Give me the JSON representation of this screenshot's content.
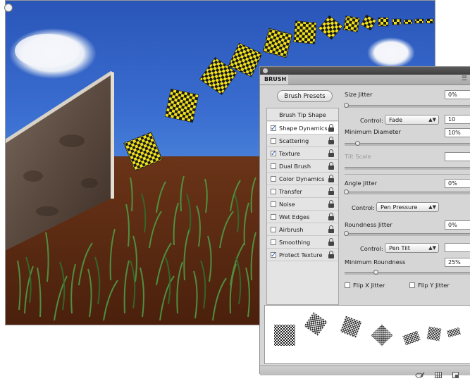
{
  "panel": {
    "title": "BRUSH",
    "menu_icon": "panel-menu-icon",
    "presets_button": "Brush Presets",
    "list": {
      "header": "Brush Tip Shape",
      "items": [
        {
          "label": "Shape Dynamics",
          "checked": true
        },
        {
          "label": "Scattering",
          "checked": false
        },
        {
          "label": "Texture",
          "checked": true
        },
        {
          "label": "Dual Brush",
          "checked": false
        },
        {
          "label": "Color Dynamics",
          "checked": false
        },
        {
          "label": "Transfer",
          "checked": false
        },
        {
          "label": "Noise",
          "checked": false
        },
        {
          "label": "Wet Edges",
          "checked": false
        },
        {
          "label": "Airbrush",
          "checked": false
        },
        {
          "label": "Smoothing",
          "checked": false
        },
        {
          "label": "Protect Texture",
          "checked": true
        }
      ]
    },
    "size_jitter": {
      "label": "Size Jitter",
      "value": "0%",
      "control_label": "Control:",
      "control": "Fade",
      "fade_steps": "10"
    },
    "minimum_diameter": {
      "label": "Minimum Diameter",
      "value": "10%"
    },
    "tilt_scale": {
      "label": "Tilt Scale",
      "value": ""
    },
    "angle_jitter": {
      "label": "Angle Jitter",
      "value": "0%",
      "control_label": "Control:",
      "control": "Pen Pressure"
    },
    "roundness_jitter": {
      "label": "Roundness Jitter",
      "value": "0%",
      "control_label": "Control:",
      "control": "Pen Tilt",
      "tilt_value": ""
    },
    "minimum_roundness": {
      "label": "Minimum Roundness",
      "value": "25%"
    },
    "flip_x": "Flip X Jitter",
    "flip_y": "Flip Y Jitter",
    "bottom_icons": [
      "toggle-live-tip-icon",
      "grid-icon",
      "new-brush-icon"
    ]
  },
  "colors": {
    "sky": "#3a6ed0",
    "ground": "#5a2a14",
    "grass": "#3e8a3a",
    "checker_yellow": "#f4e41c"
  }
}
